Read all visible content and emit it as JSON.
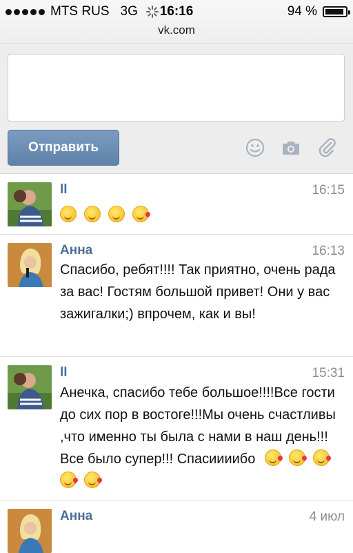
{
  "status_bar": {
    "carrier": "MTS RUS",
    "network": "3G",
    "time": "16:16",
    "battery_percent_text": "94 %",
    "battery_level": 0.94,
    "url": "vk.com"
  },
  "composer": {
    "input_value": "",
    "send_label": "Отправить",
    "icons": [
      "smiley-icon",
      "camera-icon",
      "paperclip-icon"
    ]
  },
  "messages": [
    {
      "author": "ll",
      "time": "16:15",
      "text": "",
      "emojis": [
        "smile",
        "smile",
        "smile",
        "kiss"
      ]
    },
    {
      "author": "Анна",
      "time": "16:13",
      "text": "Спасибо, ребят!!!! Так приятно, очень рада за вас! Гостям большой привет! Они у вас зажигалки;) впрочем, как и вы!",
      "emojis": []
    },
    {
      "author": "ll",
      "time": "15:31",
      "text": "Анечка, спасибо тебе большое!!!!Все гости до сих пор в востоге!!!Мы очень счастливы ,что именно ты была с нами в наш день!!!Все было супер!!! Спасиииибо",
      "emojis": [
        "kiss",
        "kiss",
        "kiss",
        "kiss",
        "kiss"
      ]
    },
    {
      "author": "Анна",
      "time": "4 июл",
      "text": "",
      "emojis": []
    }
  ],
  "colors": {
    "accent": "#5f82aa",
    "author": "#4c6e96",
    "time": "#8c8c8c"
  }
}
